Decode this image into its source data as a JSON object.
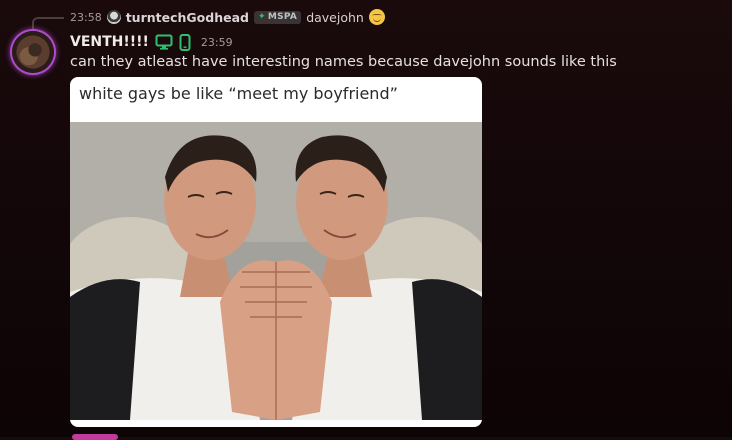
{
  "reply": {
    "time": "23:58",
    "author": "turntechGodhead",
    "tag": "MSPA",
    "content": "davejohn",
    "emoji": "relieved-face"
  },
  "message": {
    "author": "VENTH!!!!",
    "status_icons": [
      "desktop-icon",
      "mobile-icon"
    ],
    "time": "23:59",
    "text": "can they atleast have interesting names because davejohn sounds like this"
  },
  "attachment": {
    "caption": "white gays be like “meet my boyfriend”"
  },
  "colors": {
    "background": "#120608",
    "status_green": "#2fbf71",
    "avatar_ring": "#b04bd0"
  }
}
